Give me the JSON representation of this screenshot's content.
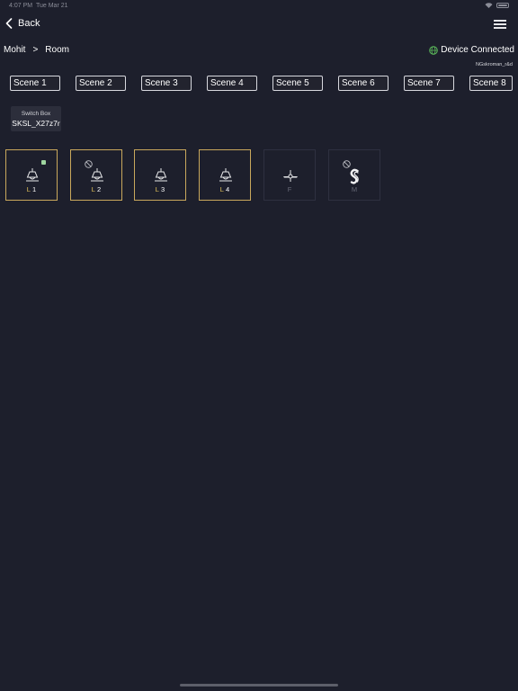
{
  "status_bar": {
    "time": "4:07 PM",
    "date": "Tue Mar 21"
  },
  "nav": {
    "back_label": "Back"
  },
  "breadcrumb": {
    "home": "Mohit",
    "separator": ">",
    "room": "Room"
  },
  "device": {
    "status": "Device Connected",
    "network": "NGskroman_r&d",
    "status_color": "#5bb75a"
  },
  "scenes": [
    "Scene 1",
    "Scene 2",
    "Scene 3",
    "Scene 4",
    "Scene 5",
    "Scene 6",
    "Scene 7",
    "Scene 8"
  ],
  "switch_box": {
    "title": "Switch Box",
    "id": "SKSL_X27z7r"
  },
  "tiles": [
    {
      "prefix": "L",
      "number": "1",
      "icon": "ceiling-lamp-icon",
      "active": true,
      "badge": "status-dot"
    },
    {
      "prefix": "L",
      "number": "2",
      "icon": "ceiling-lamp-icon",
      "active": true,
      "badge": "block"
    },
    {
      "prefix": "L",
      "number": "3",
      "icon": "ceiling-lamp-icon",
      "active": true
    },
    {
      "prefix": "L",
      "number": "4",
      "icon": "ceiling-lamp-icon",
      "active": true
    },
    {
      "prefix": "",
      "number": "F",
      "icon": "fan-icon",
      "active": false
    },
    {
      "prefix": "",
      "number": "M",
      "icon": "master-switch-icon",
      "active": false,
      "badge": "block"
    }
  ],
  "colors": {
    "background": "#1d1f2c",
    "accent": "#c9a85c",
    "label_accent": "#e5c55a"
  }
}
